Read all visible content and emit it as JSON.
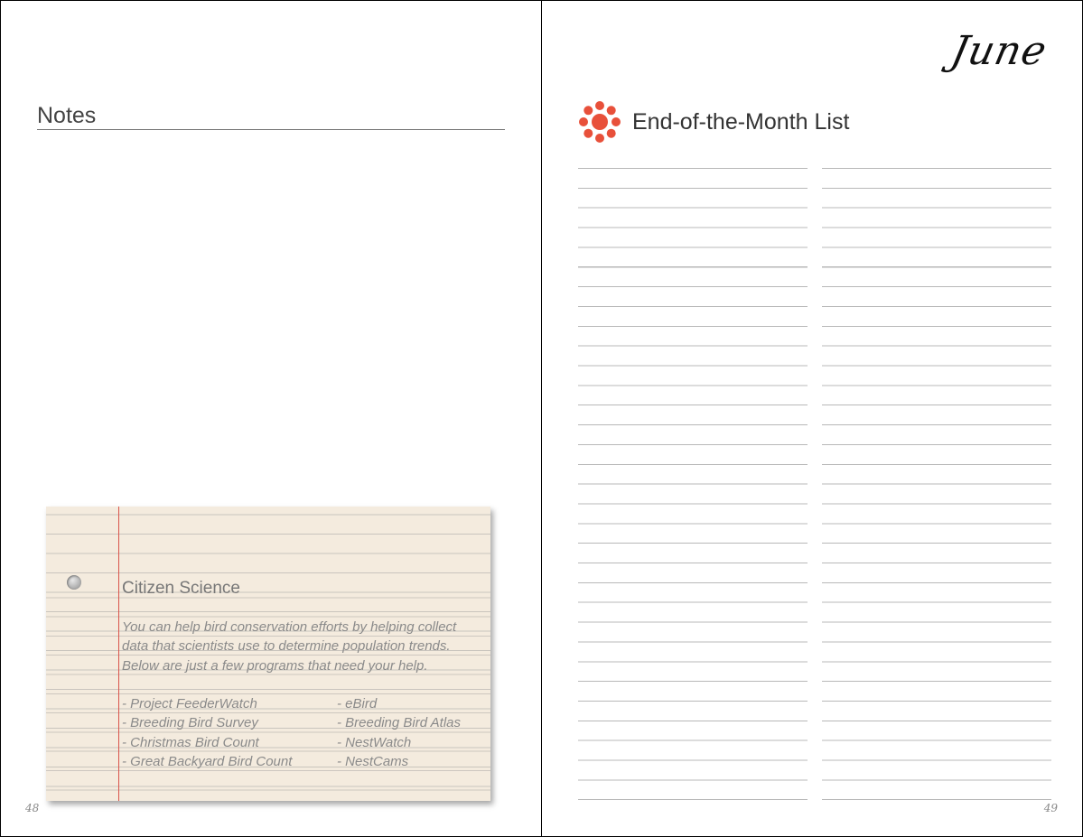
{
  "left_page": {
    "notes_title": "Notes",
    "page_number": "48",
    "card": {
      "title": "Citizen Science",
      "body_lines": [
        "You can help bird conservation efforts by helping collect",
        "data that scientists use to determine population trends.",
        "Below are just a few programs that need your help."
      ],
      "programs": [
        [
          "- Project FeederWatch",
          "- eBird"
        ],
        [
          "- Breeding Bird Survey",
          "- Breeding Bird Atlas"
        ],
        [
          "- Christmas Bird Count",
          "- NestWatch"
        ],
        [
          "- Great Backyard Bird Count",
          "- NestCams"
        ]
      ]
    }
  },
  "right_page": {
    "month": "June",
    "list_title": "End-of-the-Month List",
    "page_number": "49",
    "icon": "flower-icon",
    "accent_color": "#e8503a"
  }
}
